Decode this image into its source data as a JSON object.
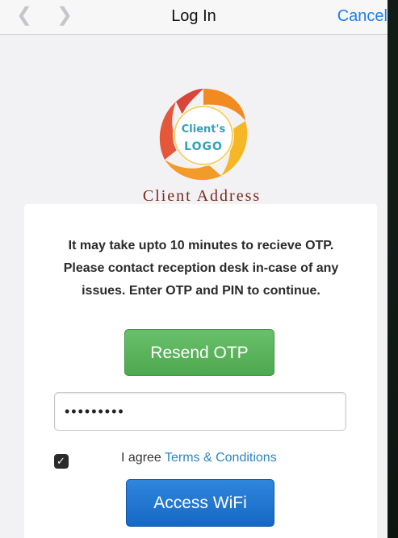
{
  "navbar": {
    "back_icon": "chevron-left-icon",
    "forward_icon": "chevron-right-icon",
    "title": "Log In",
    "cancel_label": "Cancel"
  },
  "logo": {
    "line1": "Client's",
    "line2": "LOGO",
    "address": "Client Address"
  },
  "card": {
    "info_text": "It may take upto 10 minutes to recieve OTP. Please contact reception desk in-case of any issues. Enter OTP and PIN to continue.",
    "resend_label": "Resend OTP",
    "otp_value": "•••••••••",
    "agree_checked": true,
    "agree_prefix": "I agree ",
    "terms_label": "Terms & Conditions",
    "access_label": "Access WiFi"
  },
  "colors": {
    "accent_blue": "#1f7fe6",
    "resend_green": "#5cb85c",
    "access_blue": "#1a73d2",
    "address_red": "#7a2a22"
  }
}
